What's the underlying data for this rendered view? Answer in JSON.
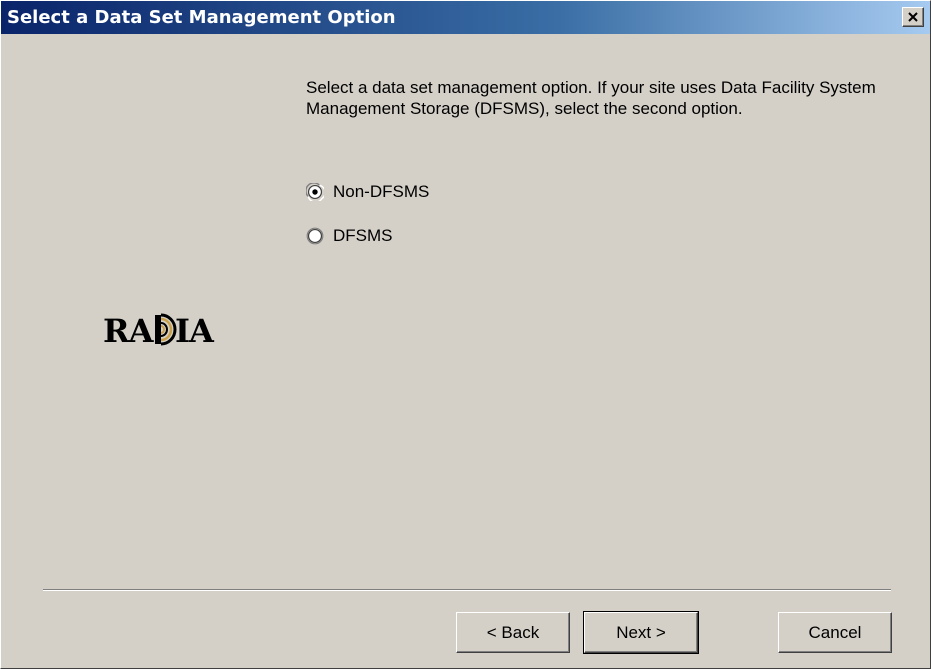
{
  "window": {
    "title": "Select a Data Set Management Option",
    "close_label": "Close"
  },
  "logo": {
    "text": "RADIA"
  },
  "content": {
    "instructions": "Select a data set management option. If your site uses Data Facility System Management Storage (DFSMS), select the second option.",
    "options": [
      {
        "label": "Non-DFSMS",
        "selected": true
      },
      {
        "label": "DFSMS",
        "selected": false
      }
    ]
  },
  "buttons": {
    "back": "< Back",
    "next": "Next >",
    "cancel": "Cancel"
  }
}
